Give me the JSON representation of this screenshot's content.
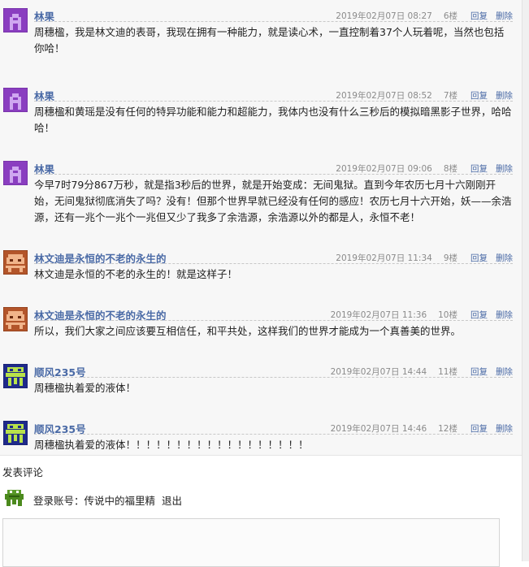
{
  "posts": [
    {
      "avatar": "purple-a-icon",
      "name": "林果",
      "time": "2019年02月07日 08:27",
      "floor": "6楼",
      "reply": "回复",
      "del": "删除",
      "content": "周穗楹，我是林文迪的表哥，我现在拥有一种能力，就是读心术，一直控制着37个人玩着呢，当然也包括你哈！"
    },
    {
      "avatar": "purple-a-icon",
      "name": "林果",
      "time": "2019年02月07日 08:52",
      "floor": "7楼",
      "reply": "回复",
      "del": "删除",
      "content": "周穗楹和黄瑶是没有任何的特异功能和能力和超能力，我体内也没有什么三秒后的模拟暗黑影子世界，哈哈哈！"
    },
    {
      "avatar": "purple-a-icon",
      "name": "林果",
      "time": "2019年02月07日 09:06",
      "floor": "8楼",
      "reply": "回复",
      "del": "删除",
      "content": "今早7时79分867万秒，就是指3秒后的世界，就是开始变成：无间鬼狱。直到今年农历七月十六刚刚开始，无间鬼狱彻底消失了吗？没有！但那个世界早就已经没有任何的感应！农历七月十六开始，妖——余浩源，还有一兆个一兆个一兆但又少了我多了余浩源，余浩源以外的都是人，永恒不老！"
    },
    {
      "avatar": "brown-robot-icon",
      "name": "林文迪是永恒的不老的永生的",
      "time": "2019年02月07日 11:34",
      "floor": "9楼",
      "reply": "回复",
      "del": "删除",
      "content": "林文迪是永恒的不老的永生的！就是这样子！"
    },
    {
      "avatar": "brown-robot-icon",
      "name": "林文迪是永恒的不老的永生的",
      "time": "2019年02月07日 11:36",
      "floor": "10楼",
      "reply": "回复",
      "del": "删除",
      "content": "所以，我们大家之间应该要互相信任，和平共处，这样我们的世界才能成为一个真善美的世界。"
    },
    {
      "avatar": "green-invader-icon",
      "name": "顺风235号",
      "time": "2019年02月07日 14:44",
      "floor": "11楼",
      "reply": "回复",
      "del": "删除",
      "content": "周穗楹执着爱的液体！"
    },
    {
      "avatar": "green-invader-icon",
      "name": "顺风235号",
      "time": "2019年02月07日 14:46",
      "floor": "12楼",
      "reply": "回复",
      "del": "删除",
      "content": "周穗楹执着爱的液体！！！！！！！！！！！！！！！！！！"
    }
  ],
  "comment": {
    "title": "发表评论",
    "login_label": "登录账号：传说中的福里精",
    "logout": "退出",
    "user_avatar": "green-frog-icon"
  },
  "colors": {
    "name_link": "#4a6aa6",
    "meta_text": "#8a8a8a",
    "list_bg": "#f7f7f7"
  }
}
